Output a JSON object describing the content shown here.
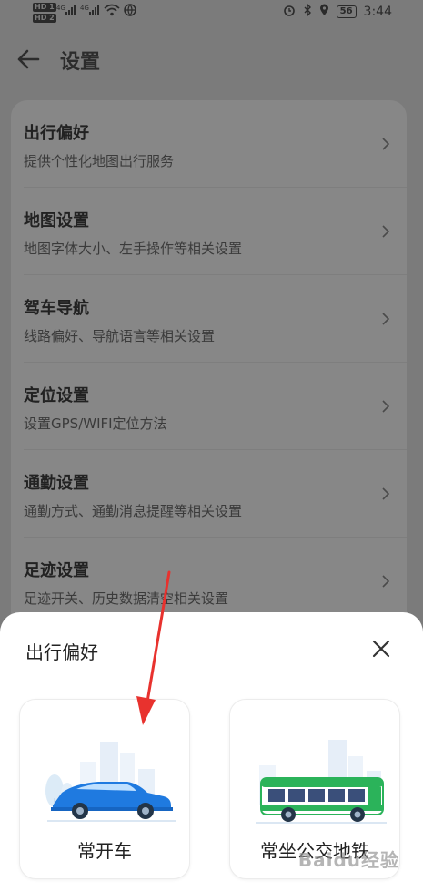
{
  "status": {
    "left_chips": [
      "HD 1",
      "HD 2"
    ],
    "network": [
      "4G",
      "4G"
    ],
    "battery": "56",
    "time": "3:44"
  },
  "header": {
    "title": "设置"
  },
  "settings": [
    {
      "title": "出行偏好",
      "subtitle": "提供个性化地图出行服务"
    },
    {
      "title": "地图设置",
      "subtitle": "地图字体大小、左手操作等相关设置"
    },
    {
      "title": "驾车导航",
      "subtitle": "线路偏好、导航语言等相关设置"
    },
    {
      "title": "定位设置",
      "subtitle": "设置GPS/WIFI定位方法"
    },
    {
      "title": "通勤设置",
      "subtitle": "通勤方式、通勤消息提醒等相关设置"
    },
    {
      "title": "足迹设置",
      "subtitle": "足迹开关、历史数据清空相关设置"
    }
  ],
  "sheet": {
    "title": "出行偏好",
    "options": [
      {
        "label": "常开车",
        "icon": "car-illustration"
      },
      {
        "label": "常坐公交地铁",
        "icon": "bus-illustration"
      }
    ]
  },
  "watermark": "Baidu经验",
  "colors": {
    "accent_red": "#e8322e",
    "car_blue": "#1f7ae0",
    "bus_green": "#2bb35a",
    "overlay": "#7b7b7b"
  }
}
